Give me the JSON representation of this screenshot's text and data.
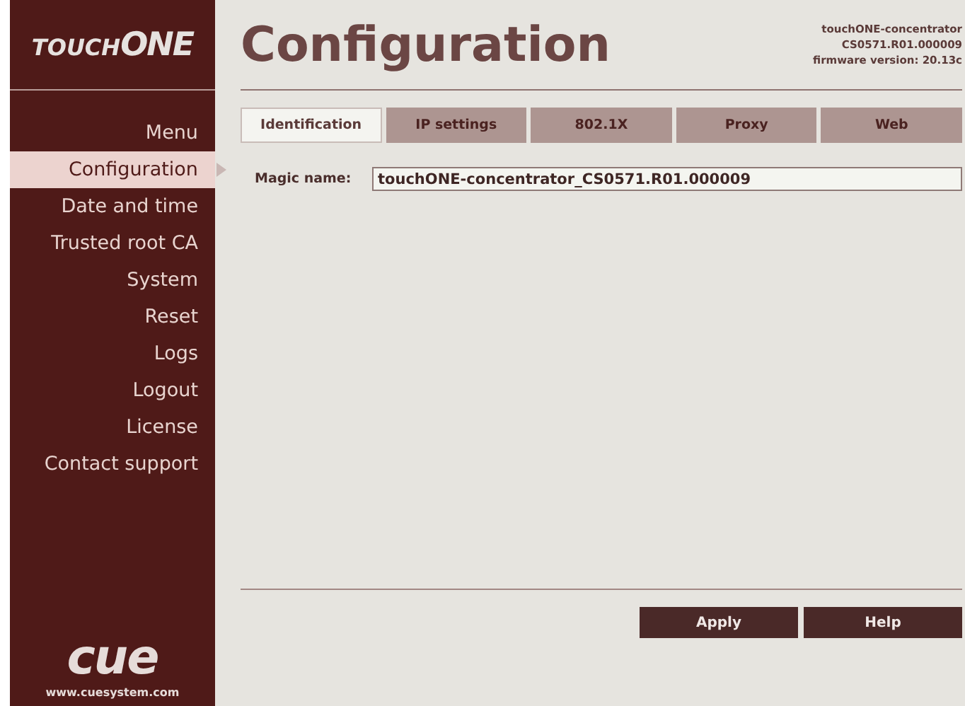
{
  "logo": {
    "part_1": "TOUCH",
    "part_2": "ONE"
  },
  "title": "Configuration",
  "device_info": [
    "touchONE-concentrator",
    "CS0571.R01.000009",
    "firmware version: 20.13c"
  ],
  "menu": [
    {
      "label": "Menu",
      "selected": false
    },
    {
      "label": "Configuration",
      "selected": true
    },
    {
      "label": "Date and time",
      "selected": false
    },
    {
      "label": "Trusted root CA",
      "selected": false
    },
    {
      "label": "System",
      "selected": false
    },
    {
      "label": "Reset",
      "selected": false
    },
    {
      "label": "Logs",
      "selected": false
    },
    {
      "label": "Logout",
      "selected": false
    },
    {
      "label": "License",
      "selected": false
    },
    {
      "label": "Contact support",
      "selected": false
    }
  ],
  "tabs": [
    {
      "label": "Identification",
      "selected": true
    },
    {
      "label": "IP settings",
      "selected": false
    },
    {
      "label": "802.1X",
      "selected": false
    },
    {
      "label": "Proxy",
      "selected": false
    },
    {
      "label": "Web",
      "selected": false
    }
  ],
  "fields": [
    {
      "label": "Magic name:",
      "value": "touchONE-concentrator_CS0571.R01.000009"
    }
  ],
  "buttons": [
    "Apply",
    "Help"
  ],
  "footer": {
    "brand": "cue",
    "url": "www.cuesystem.com"
  }
}
